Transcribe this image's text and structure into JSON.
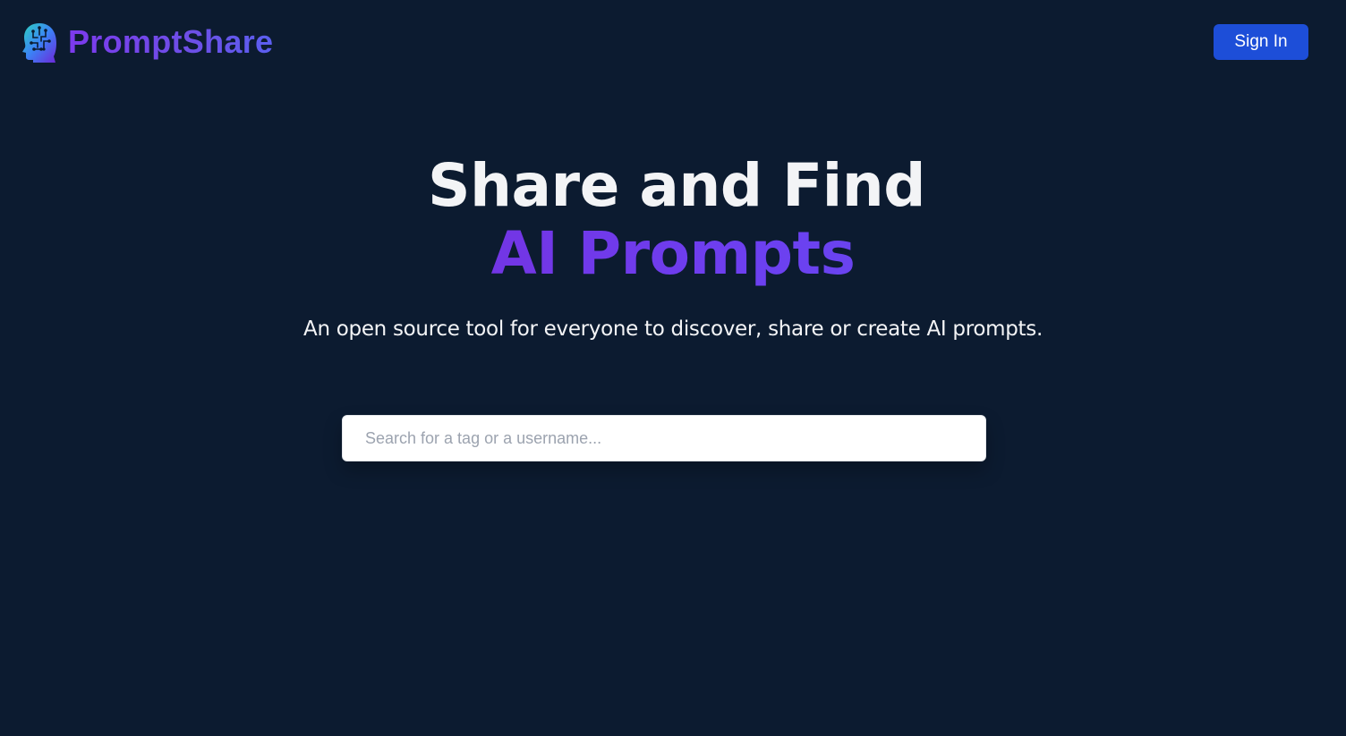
{
  "app": {
    "name": "PromptShare",
    "logo_icon": "brain-head-icon"
  },
  "nav": {
    "sign_in_label": "Sign In"
  },
  "hero": {
    "title_line1": "Share and Find",
    "title_line2": "AI Prompts",
    "subtitle": "An open source tool for everyone to discover, share or create AI prompts."
  },
  "search": {
    "placeholder": "Search for a tag or a username...",
    "value": ""
  },
  "colors": {
    "background": "#0c1b30",
    "brand_gradient_start": "#7c3aed",
    "brand_gradient_end": "#5b5ff0",
    "primary_button": "#1d4ed8",
    "heading_text": "#f3f4f6"
  }
}
